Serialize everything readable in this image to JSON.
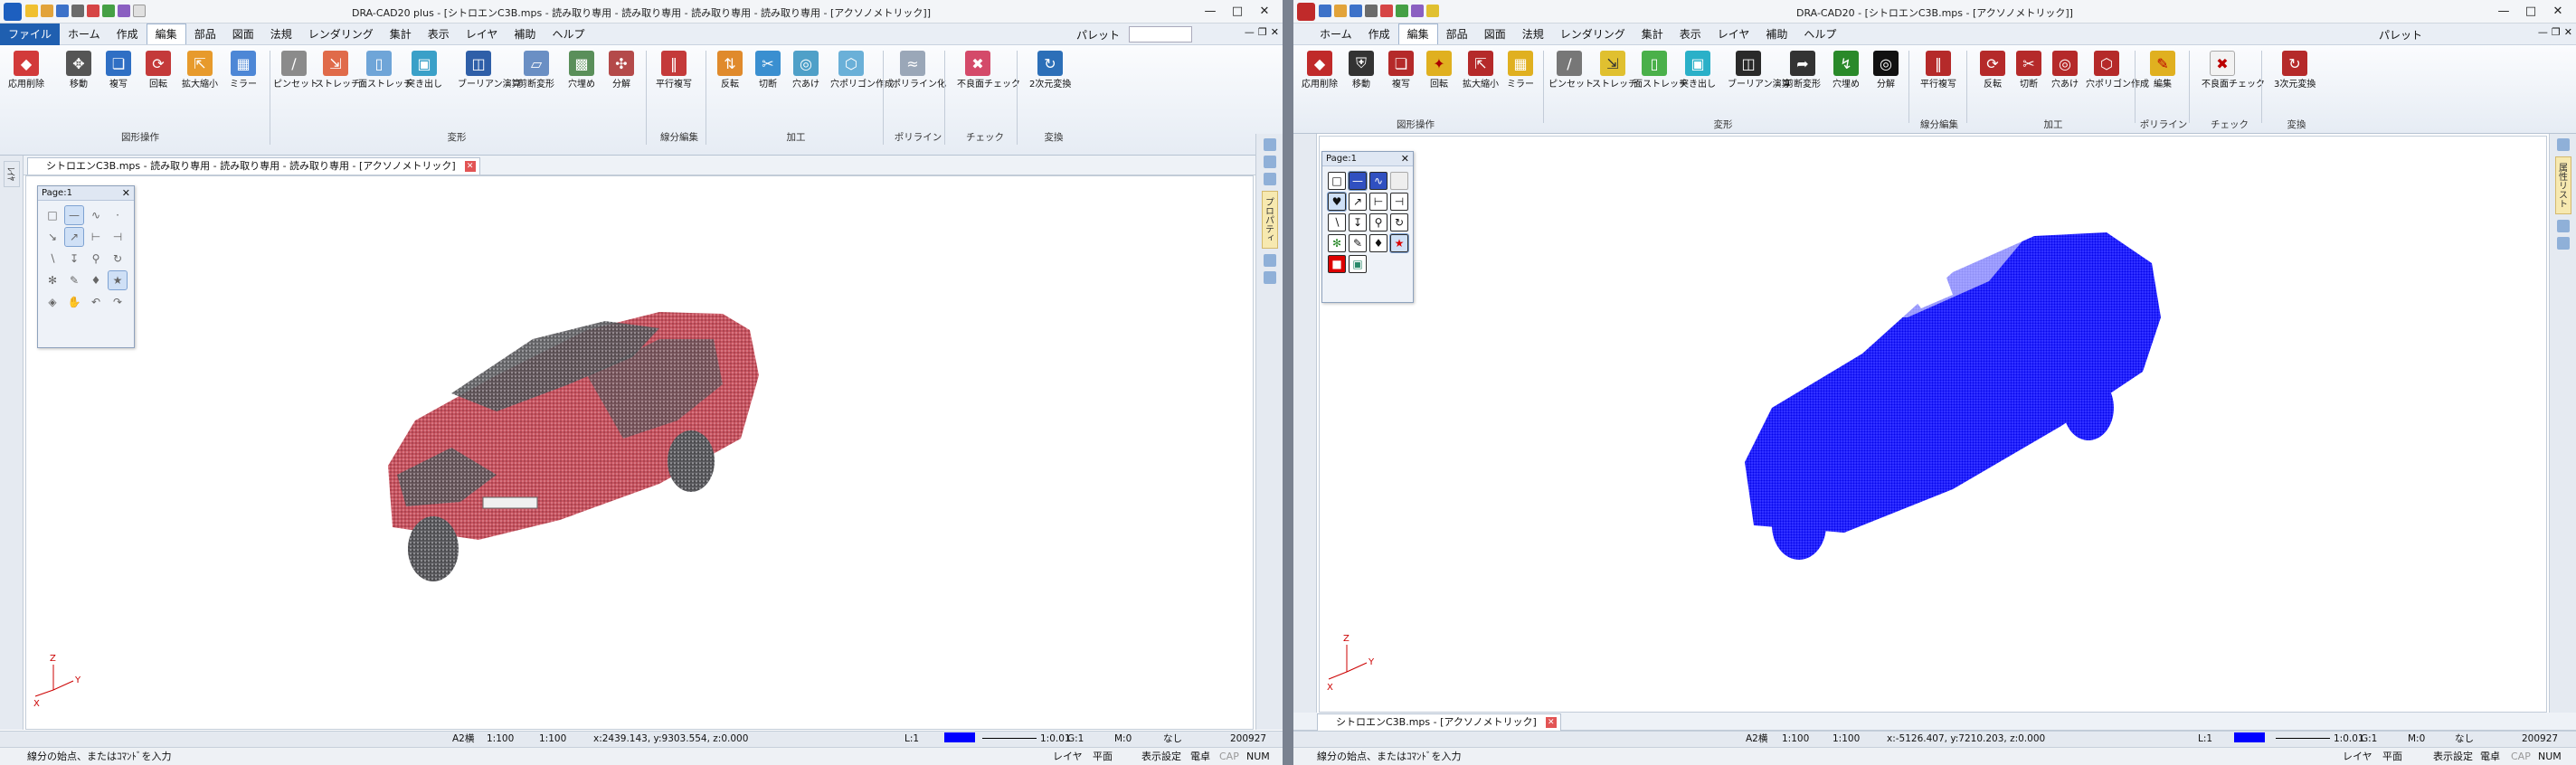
{
  "left": {
    "title": "DRA-CAD20 plus - [シトロエンC3B.mps - 読み取り専用 - 読み取り専用 - 読み取り専用 - 読み取り専用 - [アクソノメトリック]]",
    "menu": [
      "ファイル",
      "ホーム",
      "作成",
      "編集",
      "部品",
      "図面",
      "法規",
      "レンダリング",
      "集計",
      "表示",
      "レイヤ",
      "補助",
      "ヘルプ"
    ],
    "palette_label": "パレット",
    "ribbon_buttons": [
      "応用削除",
      "移動",
      "複写",
      "回転",
      "拡大縮小",
      "ミラー",
      "ピンセット",
      "ストレッチ",
      "面ストレッチ",
      "突き出し",
      "ブーリアン演算",
      "剪断変形",
      "穴埋め",
      "分解",
      "平行複写",
      "反転",
      "切断",
      "穴あけ",
      "穴ポリゴン作成",
      "ポリライン化",
      "不良面チェック",
      "2次元変換"
    ],
    "groups": [
      "図形操作",
      "変形",
      "線分編集",
      "加工",
      "ポリライン",
      "チェック",
      "変換"
    ],
    "doc_tab": "シトロエンC3B.mps - 読み取り専用 - 読み取り専用 - 読み取り専用 - [アクソノメトリック]",
    "panel_title": "Page:1",
    "right_vtab": "プロパティ",
    "status": {
      "paper": "A2横",
      "scale1": "1:100",
      "scale2": "1:100",
      "coords": "x:2439.143, y:9303.554, z:0.000",
      "layer": "L:1",
      "lw": "1:0.01",
      "grp": "G:1",
      "m": "M:0",
      "none": "なし",
      "num": "200927"
    },
    "message": "線分の始点、またはｺﾏﾝﾄﾞを入力",
    "msg_right": [
      "レイヤ",
      "平面",
      "表示設定",
      "電卓",
      "CAP",
      "NUM"
    ]
  },
  "right": {
    "title": "DRA-CAD20 - [シトロエンC3B.mps - [アクソノメトリック]]",
    "menu": [
      "ホーム",
      "作成",
      "編集",
      "部品",
      "図面",
      "法規",
      "レンダリング",
      "集計",
      "表示",
      "レイヤ",
      "補助",
      "ヘルプ"
    ],
    "palette_label": "パレット",
    "ribbon_buttons": [
      "応用削除",
      "移動",
      "複写",
      "回転",
      "拡大縮小",
      "ミラー",
      "ピンセット",
      "ストレッチ",
      "面ストレッチ",
      "突き出し",
      "ブーリアン演算",
      "剪断変形",
      "穴埋め",
      "分解",
      "平行複写",
      "反転",
      "切断",
      "穴あけ",
      "穴ポリゴン作成",
      "編集",
      "不良面チェック",
      "3次元変換"
    ],
    "groups": [
      "図形操作",
      "変形",
      "線分編集",
      "加工",
      "ポリライン",
      "チェック",
      "変換"
    ],
    "doc_tab": "シトロエンC3B.mps - [アクソノメトリック]",
    "panel_title": "Page:1",
    "right_vtab": "属性リスト",
    "status": {
      "paper": "A2横",
      "scale1": "1:100",
      "scale2": "1:100",
      "coords": "x:-5126.407, y:7210.203, z:0.000",
      "layer": "L:1",
      "lw": "1:0.01",
      "grp": "G:1",
      "m": "M:0",
      "none": "なし",
      "num": "200927"
    },
    "message": "線分の始点、またはｺﾏﾝﾄﾞを入力",
    "msg_right": [
      "レイヤ",
      "平面",
      "表示設定",
      "電卓",
      "CAP",
      "NUM"
    ]
  },
  "colors": {
    "accent": "#1f5fb0",
    "current_color_left": "#0000ff",
    "current_color_right": "#0000ff",
    "car_left": "#b83848",
    "car_right": "#0000ff"
  }
}
